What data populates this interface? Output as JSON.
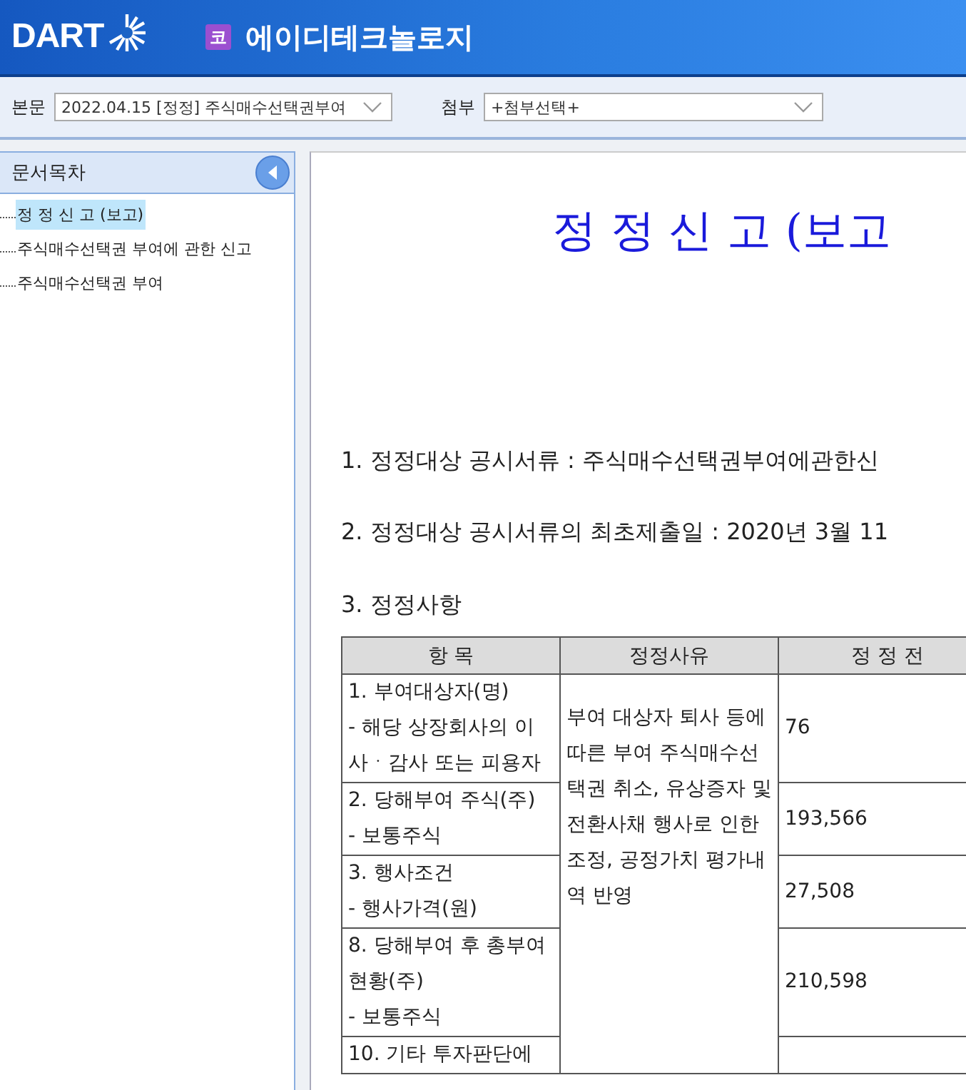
{
  "header": {
    "logo": "DART",
    "market_badge": "코",
    "company": "에이디테크놀로지"
  },
  "toolbar": {
    "main_label": "본문",
    "main_value": "2022.04.15  [정정] 주식매수선택권부여",
    "attach_label": "첨부",
    "attach_value": "+첨부선택+"
  },
  "sidebar": {
    "title": "문서목차",
    "items": [
      {
        "label": "정 정 신 고 (보고)",
        "selected": true
      },
      {
        "label": "주식매수선택권 부여에 관한 신고",
        "selected": false
      },
      {
        "label": "주식매수선택권 부여",
        "selected": false
      }
    ]
  },
  "document": {
    "title": "정 정 신 고 (보고",
    "paragraphs": [
      "1. 정정대상 공시서류 : 주식매수선택권부여에관한신",
      "2. 정정대상 공시서류의 최초제출일 : 2020년 3월 11",
      "3. 정정사항"
    ],
    "table": {
      "columns": [
        "항 목",
        "정정사유",
        "정 정 전"
      ],
      "reason": "부여 대상자 퇴사 등에 따른 부여 주식매수선택권 취소, 유상증자 및 전환사채 행사로 인한 조정, 공정가치 평가내역 반영",
      "rows": [
        {
          "item": [
            "1. 부여대상자(명)",
            "- 해당 상장회사의 이사ㆍ감사 또는 피용자"
          ],
          "before": "76"
        },
        {
          "item": [
            "2. 당해부여 주식(주)",
            "- 보통주식"
          ],
          "before": "193,566"
        },
        {
          "item": [
            "3. 행사조건",
            "- 행사가격(원)"
          ],
          "before": "27,508"
        },
        {
          "item": [
            "8. 당해부여 후 총부여현황(주)",
            "- 보통주식"
          ],
          "before": "210,598"
        },
        {
          "item": [
            "10. 기타 투자판단에"
          ],
          "before": ""
        }
      ]
    }
  }
}
